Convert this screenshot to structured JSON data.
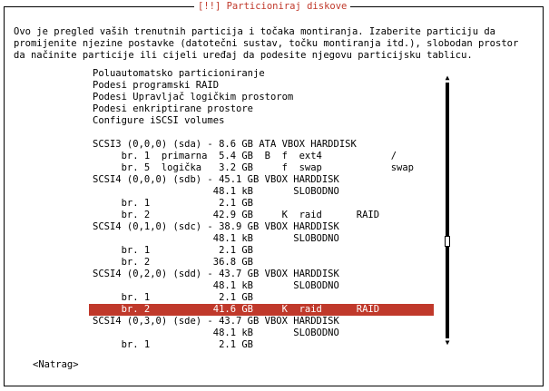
{
  "dialog": {
    "title": "[!!] Particioniraj diskove",
    "description": "Ovo je pregled vaših trenutnih particija i točaka montiranja. Izaberite particiju da\npromijenite njezine postavke (datotečni sustav, točku montiranja itd.), slobodan prostor\nda načinite particije ili cijeli uređaj da podesite njegovu particijsku tablicu."
  },
  "menu": {
    "items": [
      "Poluautomatsko particioniranje",
      "Podesi programski RAID",
      "Podesi Upravljač logičkim prostorom",
      "Podesi enkriptirane prostore",
      "Configure iSCSI volumes",
      "",
      "SCSI3 (0,0,0) (sda) - 8.6 GB ATA VBOX HARDDISK",
      "     br. 1  primarna  5.4 GB  B  f  ext4            /",
      "     br. 5  logička   3.2 GB     f  swap            swap",
      "SCSI4 (0,0,0) (sdb) - 45.1 GB VBOX HARDDISK",
      "                     48.1 kB       SLOBODNO",
      "     br. 1            2.1 GB",
      "     br. 2           42.9 GB     K  raid      RAID",
      "SCSI4 (0,1,0) (sdc) - 38.9 GB VBOX HARDDISK",
      "                     48.1 kB       SLOBODNO",
      "     br. 1            2.1 GB",
      "     br. 2           36.8 GB",
      "SCSI4 (0,2,0) (sdd) - 43.7 GB VBOX HARDDISK",
      "                     48.1 kB       SLOBODNO",
      "     br. 1            2.1 GB",
      "     br. 2           41.6 GB     K  raid      RAID",
      "SCSI4 (0,3,0) (sde) - 43.7 GB VBOX HARDDISK",
      "                     48.1 kB       SLOBODNO",
      "     br. 1            2.1 GB"
    ],
    "selected_index": 20
  },
  "scrollbar": {
    "up_icon": "▲",
    "down_icon": "▼"
  },
  "buttons": {
    "back": "<Natrag>"
  },
  "colors": {
    "accent": "#c0392b",
    "background": "#ffffff",
    "text": "#000000"
  }
}
